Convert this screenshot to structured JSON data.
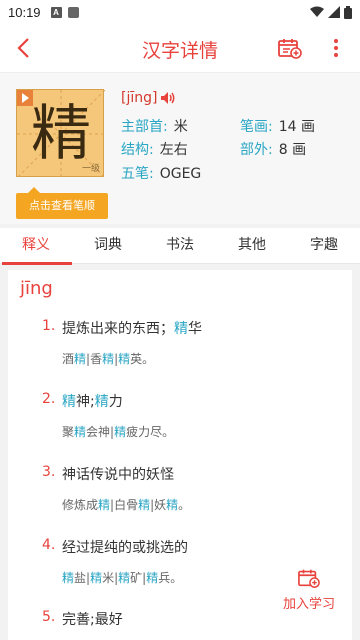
{
  "status_bar": {
    "time": "10:19",
    "icon_a": "A"
  },
  "app_bar": {
    "title": "汉字详情",
    "back_icon": "back-arrow-icon",
    "plan_icon": "calendar-add-icon",
    "more_icon": "more-vertical-icon"
  },
  "char_card": {
    "character": "精",
    "level": "一级",
    "stroke_button": "点击查看笔顺",
    "pinyin": "[jīng]",
    "radical_label": "主部首:",
    "radical_value": "米",
    "strokes_label": "笔画:",
    "strokes_value": "14 画",
    "structure_label": "结构:",
    "structure_value": "左右",
    "outer_label": "部外:",
    "outer_value": "8 画",
    "wubi_label": "五笔:",
    "wubi_value": "OGEG"
  },
  "tabs": [
    {
      "label": "释义",
      "active": true
    },
    {
      "label": "词典",
      "active": false
    },
    {
      "label": "书法",
      "active": false
    },
    {
      "label": "其他",
      "active": false
    },
    {
      "label": "字趣",
      "active": false
    }
  ],
  "content": {
    "pinyin_title": "jīng",
    "definitions": [
      {
        "num": "1.",
        "text": [
          {
            "t": "提炼出来的东西；"
          },
          {
            "t": "精",
            "hl": true
          },
          {
            "t": "华"
          }
        ],
        "example": [
          {
            "t": "酒"
          },
          {
            "t": "精",
            "hl": true
          },
          {
            "t": "|香"
          },
          {
            "t": "精",
            "hl": true
          },
          {
            "t": "|"
          },
          {
            "t": "精",
            "hl": true
          },
          {
            "t": "英。"
          }
        ]
      },
      {
        "num": "2.",
        "text": [
          {
            "t": "精",
            "hl": true
          },
          {
            "t": "神;"
          },
          {
            "t": "精",
            "hl": true
          },
          {
            "t": "力"
          }
        ],
        "example": [
          {
            "t": "聚"
          },
          {
            "t": "精",
            "hl": true
          },
          {
            "t": "会神|"
          },
          {
            "t": "精",
            "hl": true
          },
          {
            "t": "疲力尽。"
          }
        ]
      },
      {
        "num": "3.",
        "text": [
          {
            "t": "神话传说中的妖怪"
          }
        ],
        "example": [
          {
            "t": "修炼成"
          },
          {
            "t": "精",
            "hl": true
          },
          {
            "t": "|白骨"
          },
          {
            "t": "精",
            "hl": true
          },
          {
            "t": "|妖"
          },
          {
            "t": "精",
            "hl": true
          },
          {
            "t": "。"
          }
        ]
      },
      {
        "num": "4.",
        "text": [
          {
            "t": "经过提纯的或挑选的"
          }
        ],
        "example": [
          {
            "t": "精",
            "hl": true
          },
          {
            "t": "盐|"
          },
          {
            "t": "精",
            "hl": true
          },
          {
            "t": "米|"
          },
          {
            "t": "精",
            "hl": true
          },
          {
            "t": "矿|"
          },
          {
            "t": "精",
            "hl": true
          },
          {
            "t": "兵。"
          }
        ]
      },
      {
        "num": "5.",
        "text": [
          {
            "t": "完善;最好"
          }
        ],
        "example": []
      }
    ]
  },
  "add_study": {
    "label": "加入学习"
  },
  "colors": {
    "accent": "#e8423c",
    "teal": "#2aa6c4",
    "card": "#f5c77a",
    "button": "#f4a623"
  }
}
